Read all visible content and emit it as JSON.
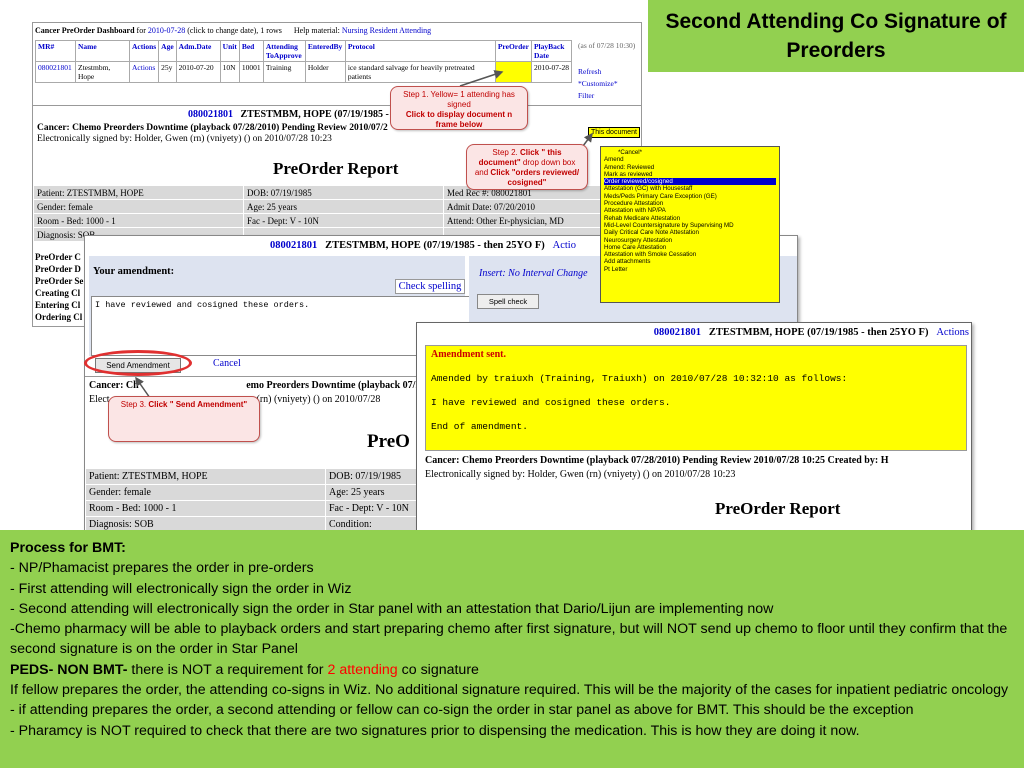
{
  "title": "Second Attending Co Signature of Preorders",
  "dashboard": {
    "head_prefix": "Cancer PreOrder Dashboard",
    "head_for": "for",
    "date": "2010-07-28",
    "head_suffix": "(click to change date), 1 rows",
    "help_label": "Help material:",
    "help_links": [
      "Nursing",
      "Resident",
      "Attending"
    ],
    "columns": [
      "MR#",
      "Name",
      "Actions",
      "Age",
      "Adm.Date",
      "Unit",
      "Bed",
      "Attending ToApprove",
      "EnteredBy",
      "Protocol",
      "PreOrder",
      "PlayBack Date"
    ],
    "row": {
      "mr": "080021801",
      "name": "Ztestmbm, Hope",
      "actions": "Actions",
      "age": "25y",
      "adm_date": "2010-07-20",
      "unit": "10N",
      "bed": "10001",
      "attending": "Training",
      "entered_by": "Holder",
      "protocol": "ice standard salvage for heavily pretreated patients",
      "preorder": "",
      "playback": "2010-07-28"
    },
    "as_of": "(as of 07/28 10:30)",
    "links": [
      "Refresh",
      "*Customize*",
      "Filter"
    ]
  },
  "report": {
    "mr": "080021801",
    "name_line": "ZTESTMBM, HOPE  (07/19/1985 -",
    "line1": "Cancer: Chemo Preorders Downtime (playback 07/28/2010) Pending Review  2010/07/2",
    "line1_tail": "n",
    "line2": "Electronically signed by: Holder, Gwen (rn) (vniyety) () on 2010/07/28 10:23",
    "this_document": "This document",
    "title": "PreOrder Report",
    "grid": [
      [
        "Patient: ZTESTMBM, HOPE",
        "DOB: 07/19/1985",
        "Med Rec #: 080021801"
      ],
      [
        "Gender: female",
        "Age: 25 years",
        "Admit Date: 07/20/2010"
      ],
      [
        "Room - Bed: 1000 - 1",
        "Fac - Dept: V - 10N",
        "Attend: Other Er-physician, MD"
      ],
      [
        "Diagnosis: SOB",
        "",
        ""
      ]
    ],
    "side_list": [
      "PreOrder C",
      "PreOrder D",
      "PreOrder Se",
      "Creating Cl",
      "Entering Cl",
      "Ordering Cl"
    ]
  },
  "dropdown": {
    "items": [
      "*Cancel*",
      "Amend",
      "Amend: Reviewed",
      "Mark as reviewed",
      "Order reviewed/cosigned",
      "Attestation (GC) with Housestaff",
      "Meds/Peds Primary Care Exception (GE)",
      "Procedure Attestation",
      "Attestation with NP/PA",
      "Rehab Medicare Attestation",
      "Mid-Level Countersignature by Supervising MD",
      "Daily Critical Care Note Attestation",
      "Neurosurgery Attestation",
      "Home Care Attestation",
      "Attestation with Smoke Cessation",
      "Add attachments",
      "Pt Letter"
    ],
    "selected_index": 4
  },
  "amendment": {
    "mr": "080021801",
    "name_line": "ZTESTMBM, HOPE   (07/19/1985 - then 25YO F)",
    "actions": "Actio",
    "label": "Your amendment:",
    "spell_check_link": "Check spelling",
    "text": "I have reviewed and cosigned these orders.",
    "insert_label": "Insert: No Interval Change",
    "spell_check_button": "Spell check",
    "send_button": "Send Amendment",
    "cancel": "Cancel",
    "line1_a": "Cancer: Ch",
    "line1_b": "emo Preorders Downtime (playback 07/28/2010) Pending",
    "line2_a": "Elect",
    "line2_b": "en (rn) (vniyety) () on 2010/07/28",
    "title": "PreO",
    "grid": [
      [
        "Patient: ZTESTMBM, HOPE",
        "DOB: 07/19/1985"
      ],
      [
        "Gender: female",
        "Age: 25 years"
      ],
      [
        "Room - Bed: 1000 - 1",
        "Fac - Dept: V - 10N"
      ],
      [
        "Diagnosis: SOB",
        "Condition:"
      ]
    ]
  },
  "sent": {
    "mr": "080021801",
    "name_line": "ZTESTMBM, HOPE   (07/19/1985 - then 25YO F)",
    "actions": "Actions",
    "title": "Amendment sent.",
    "l1": "Amended by traiuxh (Training, Traiuxh) on 2010/07/28 10:32:10 as follows:",
    "l2": "I have reviewed and cosigned these orders.",
    "l3": "End of amendment.",
    "line1": "Cancer: Chemo Preorders Downtime (playback 07/28/2010) Pending Review  2010/07/28  10:25  Created by: H",
    "line2": "Electronically signed by: Holder, Gwen (rn) (vniyety) () on 2010/07/28 10:23",
    "report_title": "PreOrder Report"
  },
  "callouts": {
    "step1_a": "Step 1. Yellow= 1 attending has signed",
    "step1_b": "Click to display document n frame below",
    "step2_a": "Step 2. ",
    "step2_b": "Click \" this document\"",
    "step2_c": " drop down box and ",
    "step2_d": "Click \"orders reviewed/ cosigned\"",
    "step3_a": "Step 3. ",
    "step3_b": "Click \" Send Amendment\""
  },
  "bottom": {
    "heading": "Process for BMT:",
    "bullets": [
      "- NP/Phamacist prepares the order in pre-orders",
      "- First attending will electronically sign the order in Wiz",
      "- Second attending will electronically sign the order in Star panel with an attestation that Dario/Lijun are implementing now",
      "-Chemo pharmacy will be able to playback orders and start preparing chemo after first signature, but will NOT send up chemo to floor until they confirm that the second signature is on the order in Star Panel"
    ],
    "peds_label": "PEDS- NON BMT-",
    "peds_text_a": " there is NOT a requirement for ",
    "peds_red": "2 attending",
    "peds_text_b": " co signature",
    "lines2": [
      "If fellow prepares the order, the attending co-signs in Wiz. No additional signature required.  This will be the majority of the cases for inpatient pediatric oncology",
      "- if attending prepares the order, a second attending or fellow can co-sign the order in star panel as above for BMT.  This should be the exception",
      "- Pharamcy is NOT required to check that there are two signatures prior to dispensing the medication.  This is how they are doing it now."
    ]
  },
  "colors": {
    "green": "#92d050",
    "yellow": "#ffff00",
    "link_blue": "#0000cc",
    "callout_red": "#c00000"
  }
}
